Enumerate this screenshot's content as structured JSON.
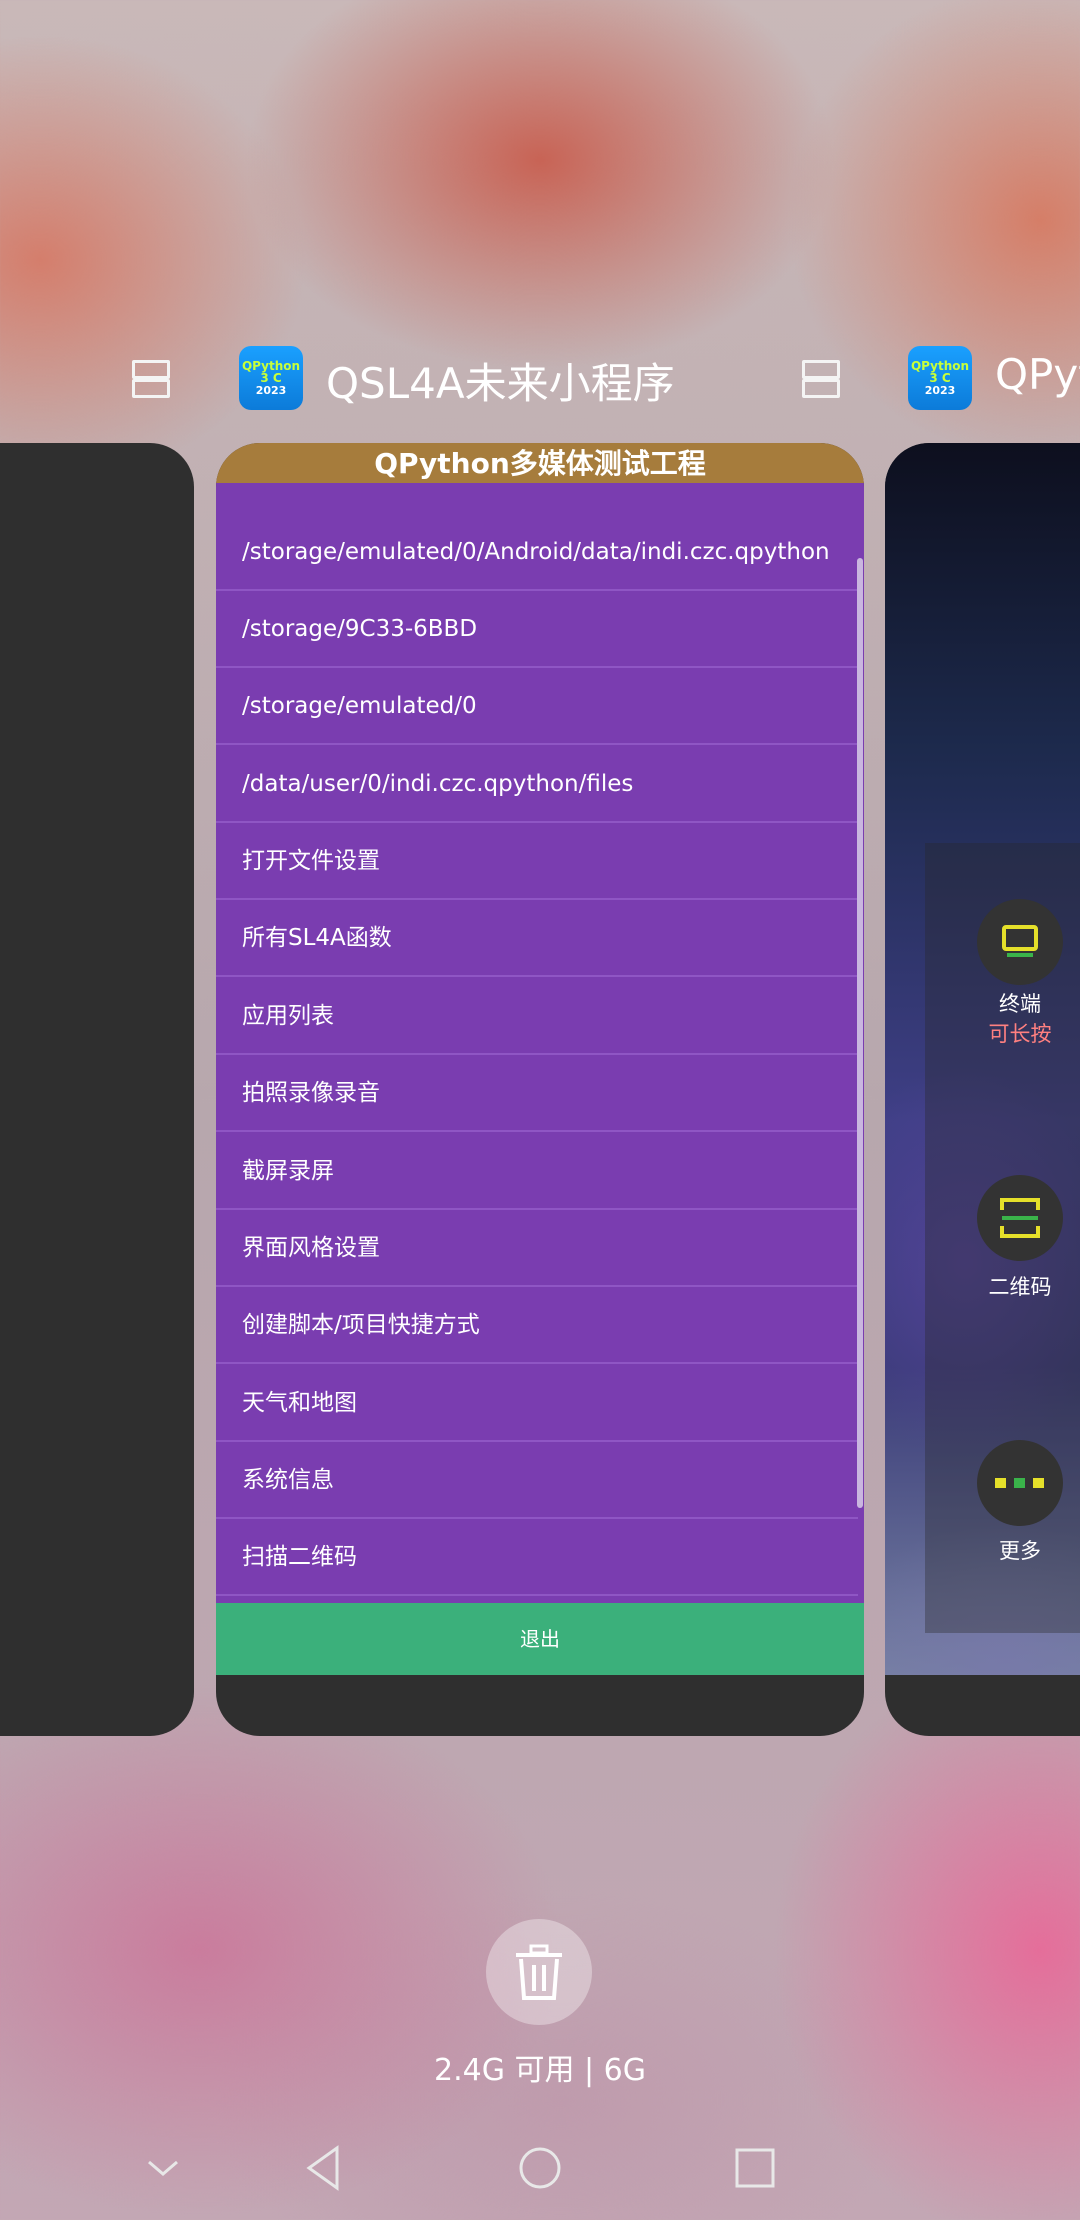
{
  "header_left": {
    "stack_icon": "split-screen-icon"
  },
  "header_center": {
    "app_icon_lines": [
      "QPython",
      "3 C",
      "2023"
    ],
    "app_title": "QSL4A未来小程序",
    "stack_icon": "split-screen-icon"
  },
  "header_right": {
    "app_icon_lines": [
      "QPython",
      "3 C",
      "2023"
    ],
    "app_title_partial": "QPyt"
  },
  "main_card": {
    "title": "QPython多媒体测试工程",
    "items": [
      "/storage/emulated/0/Android/data/indi.czc.qpython",
      "/storage/9C33-6BBD",
      "/storage/emulated/0",
      "/data/user/0/indi.czc.qpython/files",
      "打开文件设置",
      "所有SL4A函数",
      "应用列表",
      "拍照录像录音",
      "截屏录屏",
      "界面风格设置",
      "创建脚本/项目快捷方式",
      "天气和地图",
      "系统信息",
      "扫描二维码"
    ],
    "exit_label": "退出"
  },
  "right_card": {
    "terminal_label": "终端",
    "terminal_hint": "可长按",
    "qrcode_label": "二维码",
    "more_label": "更多"
  },
  "bottom": {
    "memory_text": "2.4G 可用 | 6G"
  },
  "colors": {
    "list_bg": "#7a3db0",
    "title_bar": "#a67c3c",
    "exit_button": "#3bb07b"
  }
}
